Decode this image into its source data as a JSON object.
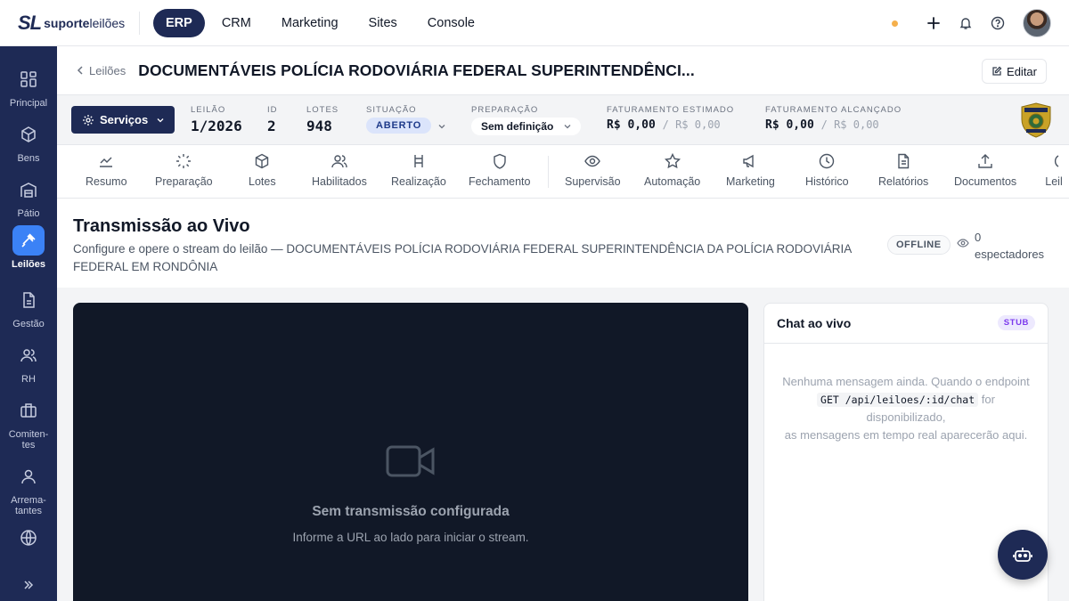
{
  "brand": {
    "mark": "SL",
    "name_bold": "suporte",
    "name_light": "leilões"
  },
  "topnav": [
    "ERP",
    "CRM",
    "Marketing",
    "Sites",
    "Console"
  ],
  "sidebar": {
    "items": [
      {
        "label": "Principal",
        "icon": "grid-icon"
      },
      {
        "label": "Bens",
        "icon": "box-icon"
      },
      {
        "label": "Pátio",
        "icon": "warehouse-icon"
      },
      {
        "label": "Leilões",
        "icon": "gavel-icon",
        "active": true
      },
      {
        "label": "Gestão",
        "icon": "document-icon"
      },
      {
        "label": "RH",
        "icon": "users-icon"
      },
      {
        "label": "Comiten-\ntes",
        "icon": "briefcase-icon"
      },
      {
        "label": "Arrema-\ntantes",
        "icon": "user-icon"
      },
      {
        "label": "",
        "icon": "globe-icon"
      }
    ],
    "expand_icon": "double-chevron-right-icon"
  },
  "header": {
    "back_label": "Leilões",
    "title": "DOCUMENTÁVEIS POLÍCIA RODOVIÁRIA FEDERAL SUPERINTENDÊNCI...",
    "edit_label": "Editar"
  },
  "info": {
    "services_label": "Serviços",
    "leilao": {
      "label": "LEILÃO",
      "value": "1/2026"
    },
    "id": {
      "label": "ID",
      "value": "2"
    },
    "lotes": {
      "label": "LOTES",
      "value": "948"
    },
    "situacao": {
      "label": "SITUAÇÃO",
      "value": "ABERTO"
    },
    "preparacao": {
      "label": "PREPARAÇÃO",
      "value": "Sem definição"
    },
    "fat_estimado": {
      "label": "FATURAMENTO ESTIMADO",
      "value": "R$ 0,00",
      "secondary": "/ R$ 0,00"
    },
    "fat_alcancado": {
      "label": "FATURAMENTO ALCANÇADO",
      "value": "R$ 0,00",
      "secondary": "/ R$ 0,00"
    },
    "emblem": "police-badge-icon"
  },
  "tabs": [
    "Resumo",
    "Preparação",
    "Lotes",
    "Habilitados",
    "Realização",
    "Fechamento",
    "Supervisão",
    "Automação",
    "Marketing",
    "Histórico",
    "Relatórios",
    "Documentos",
    "Leil"
  ],
  "stream": {
    "title": "Transmissão ao Vivo",
    "subtitle": "Configure e opere o stream do leilão — DOCUMENTÁVEIS POLÍCIA RODOVIÁRIA FEDERAL SUPERINTENDÊNCIA DA POLÍCIA RODOVIÁRIA FEDERAL EM RONDÔNIA",
    "status": "OFFLINE",
    "viewers_count": "0",
    "viewers_label": "espectadores"
  },
  "player": {
    "empty_title": "Sem transmissão configurada",
    "empty_sub": "Informe a URL ao lado para iniciar o stream."
  },
  "chat": {
    "title": "Chat ao vivo",
    "badge": "STUB",
    "empty_line1": "Nenhuma mensagem ainda. Quando o endpoint",
    "endpoint": "GET /api/leiloes/:id/chat",
    "empty_line2": "for",
    "empty_line3": "disponibilizado,",
    "empty_line4": "as mensagens em tempo real aparecerão aqui."
  },
  "colors": {
    "navy": "#1e2a55",
    "accent": "#3b82f6",
    "player_bg": "#111827"
  }
}
